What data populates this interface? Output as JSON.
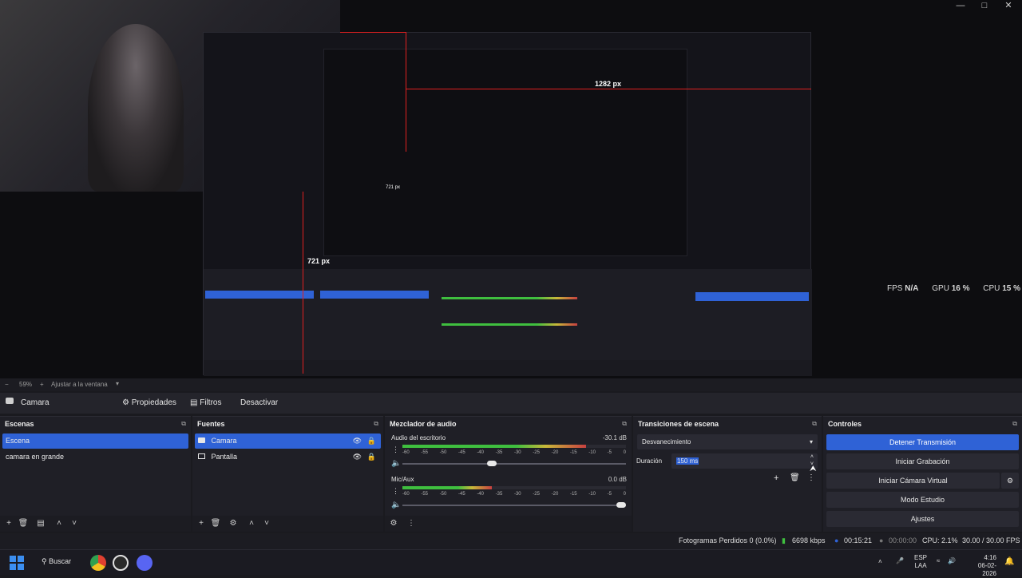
{
  "preview": {
    "fps_label": "FPS",
    "fps_value": "N/A",
    "gpu_label": "GPU",
    "gpu_value": "16 %",
    "cpu_label": "CPU",
    "cpu_value": "15 %",
    "width_label": "1282 px",
    "height_label": "721 px",
    "nested_width_label": "721 px"
  },
  "zoom": {
    "minus": "−",
    "value": "59%",
    "plus": "+",
    "fit_label": "Ajustar a la ventana"
  },
  "source_toolbar": {
    "source_name": "Camara",
    "properties": "Propiedades",
    "filters": "Filtros",
    "deactivate": "Desactivar"
  },
  "scenes": {
    "title": "Escenas",
    "items": [
      "Escena",
      "camara en grande"
    ]
  },
  "sources": {
    "title": "Fuentes",
    "items": [
      "Camara",
      "Pantalla"
    ]
  },
  "mixer": {
    "title": "Mezclador de audio",
    "channels": [
      {
        "name": "Audio del escritorio",
        "db": "-30.1 dB",
        "level": 0.82
      },
      {
        "name": "Mic/Aux",
        "db": "0.0 dB",
        "level": 0.4
      }
    ],
    "ticks": [
      "-60",
      "-55",
      "-50",
      "-45",
      "-40",
      "-35",
      "-30",
      "-25",
      "-20",
      "-15",
      "-10",
      "-5",
      "0"
    ]
  },
  "transitions": {
    "title": "Transiciones de escena",
    "selected": "Desvanecimiento",
    "duration_label": "Duración",
    "duration_value": "150 ms"
  },
  "controls": {
    "title": "Controles",
    "buttons": [
      "Detener Transmisión",
      "Iniciar Grabación",
      "Iniciar Cámara Virtual",
      "Modo Estudio",
      "Ajustes"
    ]
  },
  "status": {
    "dropped": "Fotogramas Perdidos 0 (0.0%)",
    "bitrate": "6698 kbps",
    "stream_time": "00:15:21",
    "rec_time": "00:00:00",
    "cpu": "CPU: 2.1%",
    "fps": "30.00 / 30.00 FPS"
  },
  "taskbar": {
    "search": "Buscar",
    "lang_top": "ESP",
    "lang_bottom": "LAA",
    "time": "4:16",
    "date": "06-02-2026"
  },
  "colors": {
    "accent": "#2f62d6",
    "meter_green": "#3fbf3f",
    "meter_yellow": "#c9b83a",
    "meter_red": "#c74040"
  }
}
